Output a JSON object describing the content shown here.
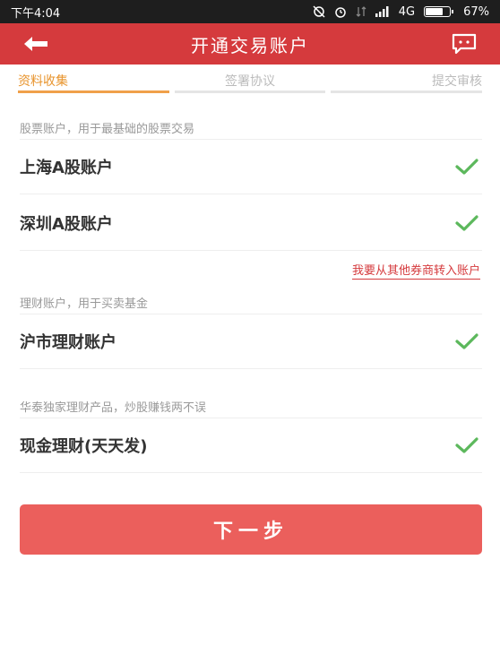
{
  "status_bar": {
    "time": "下午4:04",
    "network": "4G",
    "battery": "67%",
    "battery_level": 0.67
  },
  "header": {
    "title": "开通交易账户",
    "back_icon": "arrow-left-icon",
    "chat_icon": "chat-bubble-icon",
    "accent_color": "#d53a3d"
  },
  "steps": [
    {
      "label": "资料收集",
      "active": true
    },
    {
      "label": "签署协议",
      "active": false
    },
    {
      "label": "提交审核",
      "active": false
    }
  ],
  "sections": {
    "stock": {
      "label": "股票账户，用于最基础的股票交易",
      "items": [
        {
          "label": "上海A股账户",
          "checked": true
        },
        {
          "label": "深圳A股账户",
          "checked": true
        }
      ]
    },
    "transfer_link": "我要从其他券商转入账户",
    "wealth": {
      "label": "理财账户，用于买卖基金",
      "items": [
        {
          "label": "沪市理财账户",
          "checked": true
        }
      ]
    },
    "exclusive": {
      "label": "华泰独家理财产品，炒股赚钱两不误",
      "items": [
        {
          "label": "现金理财(天天发)",
          "checked": true
        }
      ]
    }
  },
  "next_button": "下一步",
  "colors": {
    "check": "#5cb85c",
    "button": "#eb5f5c",
    "step_active": "#e8942d"
  }
}
